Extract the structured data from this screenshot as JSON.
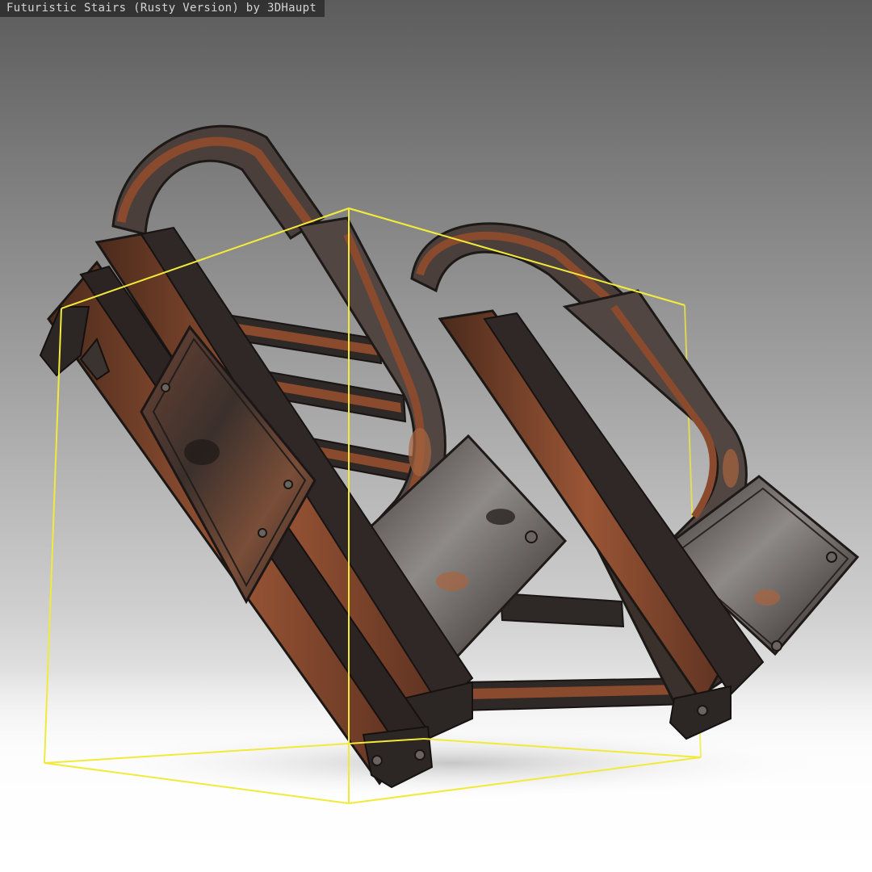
{
  "viewer": {
    "title": "Futuristic Stairs (Rusty Version) by 3DHaupt"
  },
  "colors": {
    "background_top": "#5c5c5c",
    "background_bottom": "#f8f8f8",
    "bounding_box": "#f2ea3a",
    "rust": "#8a4a2e",
    "metal_dark": "#2b2624",
    "metal_mid": "#5a5350",
    "metal_light": "#9c9896"
  },
  "icons": {
    "model": "rusty-stairs-model",
    "selection": "bounding-box-wireframe"
  }
}
